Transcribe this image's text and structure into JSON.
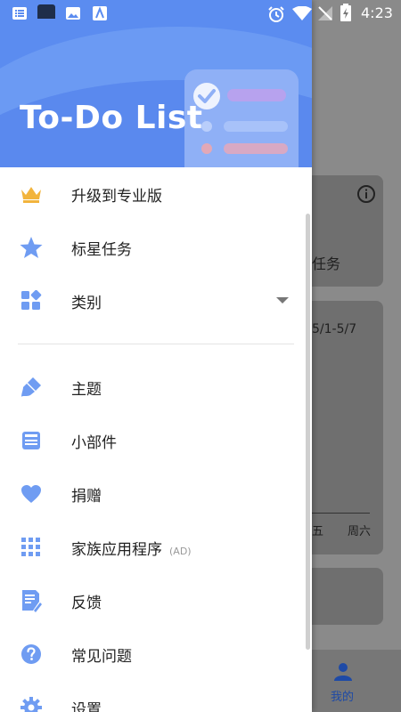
{
  "status_bar": {
    "time": "4:23"
  },
  "header": {
    "title": "To-Do List"
  },
  "menu": {
    "items": [
      {
        "label": "升级到专业版",
        "icon": "crown-icon"
      },
      {
        "label": "标星任务",
        "icon": "star-icon"
      },
      {
        "label": "类别",
        "icon": "category-icon"
      },
      {
        "label": "主题",
        "icon": "brush-icon"
      },
      {
        "label": "小部件",
        "icon": "widget-icon"
      },
      {
        "label": "捐赠",
        "icon": "heart-icon"
      },
      {
        "label": "家族应用程序",
        "badge": "(AD)",
        "icon": "grid-icon"
      },
      {
        "label": "反馈",
        "icon": "feedback-icon"
      },
      {
        "label": "常见问题",
        "icon": "question-icon"
      },
      {
        "label": "设置",
        "icon": "gear-icon"
      }
    ]
  },
  "background": {
    "card_text_1": "任务",
    "card_text_2": "5/1-5/7",
    "weekday_1": "五",
    "weekday_2": "周六",
    "bottom_tab": "我的"
  },
  "colors": {
    "accent": "#5b8cf0",
    "icon_blue": "#6f9cf2",
    "crown": "#f2b43c"
  }
}
